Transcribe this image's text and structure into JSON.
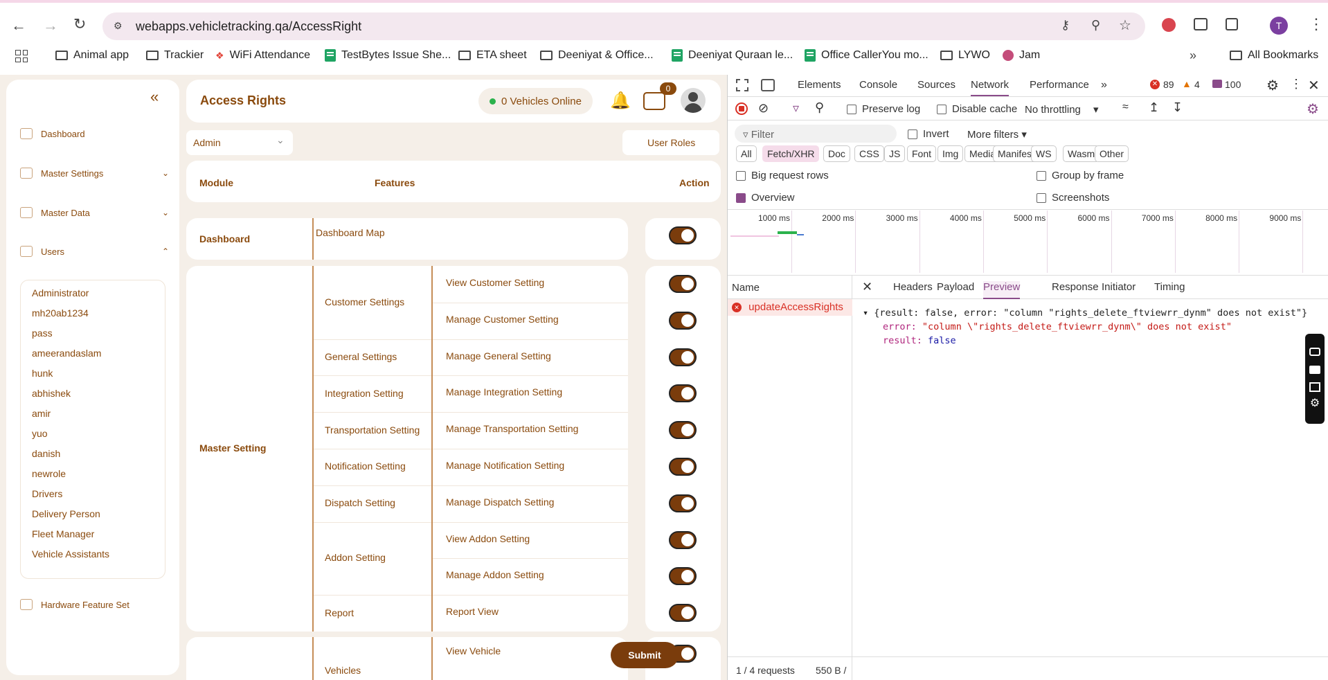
{
  "browser": {
    "url": "webapps.vehicletracking.qa/AccessRight",
    "profile_initial": "T",
    "bookmarks": [
      "Animal app",
      "Trackier",
      "WiFi Attendance",
      "TestBytes Issue She...",
      "ETA sheet",
      "Deeniyat & Office...",
      "Deeniyat Quraan le...",
      "Office CallerYou mo...",
      "LYWO",
      "Jam"
    ],
    "all_bookmarks": "All Bookmarks"
  },
  "sidebar": {
    "items": [
      {
        "label": "Dashboard"
      },
      {
        "label": "Master Settings"
      },
      {
        "label": "Master Data"
      },
      {
        "label": "Users"
      }
    ],
    "users": [
      "Administrator",
      "mh20ab1234",
      "pass",
      "ameerandaslam",
      "hunk",
      "abhishek",
      "amir",
      "yuo",
      "danish",
      "newrole",
      "Drivers",
      "Delivery Person",
      "Fleet Manager",
      "Vehicle Assistants"
    ],
    "hardware": "Hardware Feature Set"
  },
  "header": {
    "title": "Access Rights",
    "vehicles_online": "0 Vehicles Online",
    "message_badge": "0"
  },
  "controls": {
    "role_select": "Admin",
    "user_roles_button": "User Roles",
    "submit_button": "Submit"
  },
  "table": {
    "headers": {
      "module": "Module",
      "features": "Features",
      "action": "Action"
    },
    "dashboard": {
      "module": "Dashboard",
      "feature": "Dashboard Map",
      "enabled": true
    },
    "master": {
      "module": "Master Setting",
      "groups": [
        "Customer Settings",
        "General Settings",
        "Integration Setting",
        "Transportation Setting",
        "Notification Setting",
        "Dispatch Setting",
        "Addon Setting",
        "Report"
      ],
      "features": [
        "View Customer Setting",
        "Manage Customer Setting",
        "Manage General Setting",
        "Manage Integration Setting",
        "Manage Transportation Setting",
        "Manage Notification Setting",
        "Manage Dispatch Setting",
        "View Addon Setting",
        "Manage Addon Setting",
        "Report View"
      ],
      "enabled": [
        true,
        true,
        true,
        true,
        true,
        true,
        true,
        true,
        true,
        true
      ]
    },
    "vehicles": {
      "group": "Vehicles",
      "feature": "View Vehicle",
      "enabled": true
    }
  },
  "devtools": {
    "tabs": [
      "Elements",
      "Console",
      "Sources",
      "Network",
      "Performance"
    ],
    "active_tab": "Network",
    "errors": "89",
    "warnings": "4",
    "messages": "100",
    "toolbar": {
      "preserve_log": "Preserve log",
      "disable_cache": "Disable cache",
      "throttling": "No throttling"
    },
    "filter_placeholder": "Filter",
    "invert": "Invert",
    "more_filters": "More filters",
    "type_filters": [
      "All",
      "Fetch/XHR",
      "Doc",
      "CSS",
      "JS",
      "Font",
      "Img",
      "Media",
      "Manifest",
      "WS",
      "Wasm",
      "Other"
    ],
    "active_filter": "Fetch/XHR",
    "options": {
      "big_rows": "Big request rows",
      "group_frame": "Group by frame",
      "overview": "Overview",
      "screenshots": "Screenshots"
    },
    "timeline_ticks": [
      "1000 ms",
      "2000 ms",
      "3000 ms",
      "4000 ms",
      "5000 ms",
      "6000 ms",
      "7000 ms",
      "8000 ms",
      "9000 ms"
    ],
    "name_header": "Name",
    "request": "updateAccessRights",
    "detail_tabs": [
      "Headers",
      "Payload",
      "Preview",
      "Response",
      "Initiator",
      "Timing"
    ],
    "active_detail": "Preview",
    "preview_summary": "{result: false, error: \"column \"rights_delete_ftviewrr_dynm\" does not exist\"}",
    "preview_error_key": "error:",
    "preview_error_value": "\"column \\\"rights_delete_ftviewrr_dynm\\\" does not exist\"",
    "preview_result_key": "result:",
    "preview_result_value": "false",
    "status_requests": "1 / 4 requests",
    "status_size": "550 B /"
  },
  "colors": {
    "brand": "#8a4a0d",
    "toggle": "#7a3c0c",
    "accent_devtools": "#8a4b8a"
  }
}
